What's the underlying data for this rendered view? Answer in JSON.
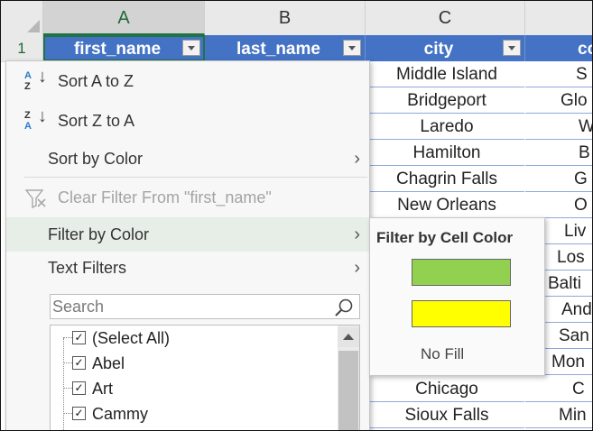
{
  "columns": [
    "A",
    "B",
    "C"
  ],
  "row_numbers": [
    "1"
  ],
  "table": {
    "headers": [
      "first_name",
      "last_name",
      "city",
      "co"
    ],
    "city_values": [
      "Middle Island",
      "Bridgeport",
      "Laredo",
      "Hamilton",
      "Chagrin Falls",
      "New Orleans",
      "Chicago",
      "Sioux Falls"
    ],
    "col_d_values": [
      "S",
      "Glo",
      "W",
      "B",
      "G",
      "O",
      "Liv",
      "Los",
      "Balti",
      "And",
      "San",
      "Mon",
      "C",
      "Min"
    ]
  },
  "menu": {
    "sort_a_z": "Sort A to Z",
    "sort_z_a": "Sort Z to A",
    "sort_by_color": "Sort by Color",
    "clear_filter": "Clear Filter From \"first_name\"",
    "filter_by_color": "Filter by Color",
    "text_filters": "Text Filters",
    "search_placeholder": "Search",
    "list_items": [
      {
        "label": "(Select All)",
        "checked": true
      },
      {
        "label": "Abel",
        "checked": true
      },
      {
        "label": "Art",
        "checked": true
      },
      {
        "label": "Cammy",
        "checked": true
      }
    ]
  },
  "submenu": {
    "title": "Filter by Cell Color",
    "colors": [
      "#92d050",
      "#ffff00"
    ],
    "no_fill": "No Fill"
  },
  "icons": [
    "sort-az-icon",
    "sort-za-icon",
    "clear-filter-icon",
    "search-icon",
    "chevron-right-icon",
    "dropdown-arrow-icon"
  ]
}
